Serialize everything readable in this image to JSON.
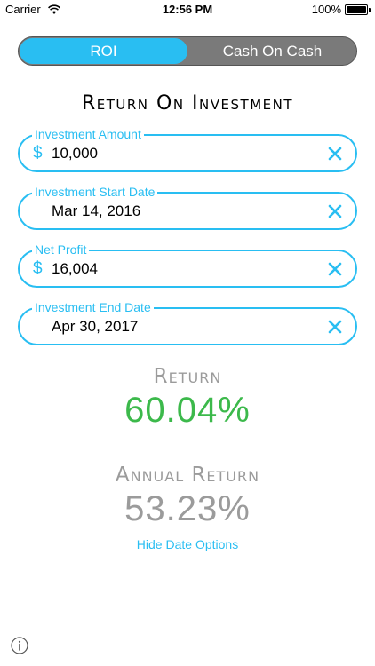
{
  "status_bar": {
    "carrier": "Carrier",
    "time": "12:56 PM",
    "battery": "100%"
  },
  "tabs": [
    {
      "label": "ROI",
      "active": true
    },
    {
      "label": "Cash On Cash",
      "active": false
    }
  ],
  "page_title": "Return On Investment",
  "fields": {
    "investment_amount": {
      "label": "Investment Amount",
      "currency": "$",
      "value": "10,000"
    },
    "start_date": {
      "label": "Investment Start Date",
      "value": "Mar 14, 2016"
    },
    "net_profit": {
      "label": "Net Profit",
      "currency": "$",
      "value": "16,004"
    },
    "end_date": {
      "label": "Investment End Date",
      "value": "Apr 30, 2017"
    }
  },
  "results": {
    "return_label": "Return",
    "return_value": "60.04%",
    "annual_label": "Annual Return",
    "annual_value": "53.23%"
  },
  "hide_date_options": "Hide Date Options",
  "colors": {
    "accent": "#29bef2",
    "positive": "#3cb94b",
    "muted": "#9b9b9b"
  },
  "icons": {
    "wifi": "wifi-icon",
    "battery": "battery-icon",
    "clear": "close-icon",
    "info": "info-icon"
  }
}
